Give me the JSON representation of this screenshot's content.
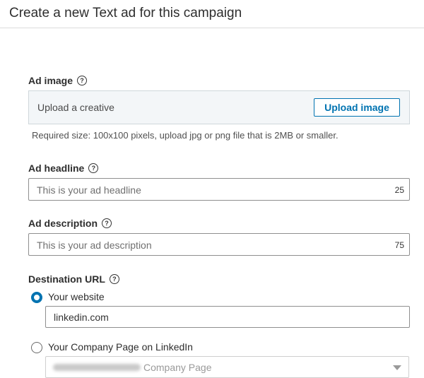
{
  "header": {
    "title": "Create a new Text ad for this campaign"
  },
  "ad_image": {
    "label": "Ad image",
    "help_icon": "question-circle-icon",
    "upload_prompt": "Upload a creative",
    "upload_button": "Upload image",
    "requirements": "Required size: 100x100 pixels, upload jpg or png file that is 2MB or smaller."
  },
  "ad_headline": {
    "label": "Ad headline",
    "placeholder": "This is your ad headline",
    "char_count": "25"
  },
  "ad_description": {
    "label": "Ad description",
    "placeholder": "This is your ad description",
    "char_count": "75"
  },
  "destination": {
    "label": "Destination URL",
    "website_option": "Your website",
    "website_selected": true,
    "website_url": "linkedin.com",
    "company_option": "Your Company Page on LinkedIn",
    "company_selected": false,
    "company_page_suffix": "Company Page"
  },
  "colors": {
    "accent": "#0073b1",
    "upload_bg": "#f3f6f8"
  }
}
